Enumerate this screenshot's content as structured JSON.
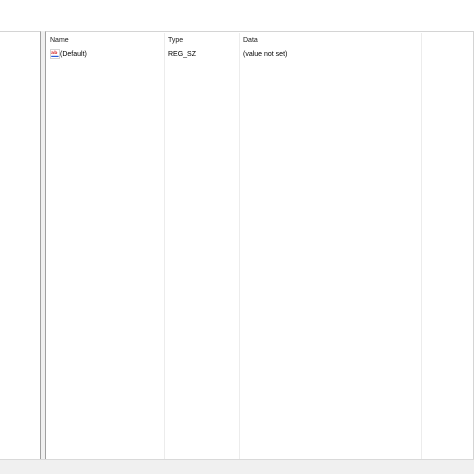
{
  "values_list": {
    "columns": {
      "name": "Name",
      "type": "Type",
      "data": "Data"
    },
    "rows": [
      {
        "icon": "reg-sz-string-icon",
        "name": "(Default)",
        "type": "REG_SZ",
        "data": "(value not set)"
      }
    ]
  },
  "colors": {
    "icon_red": "#d83b3b",
    "icon_blue": "#2a5bd7",
    "status_bar": "#f0f0f0"
  }
}
